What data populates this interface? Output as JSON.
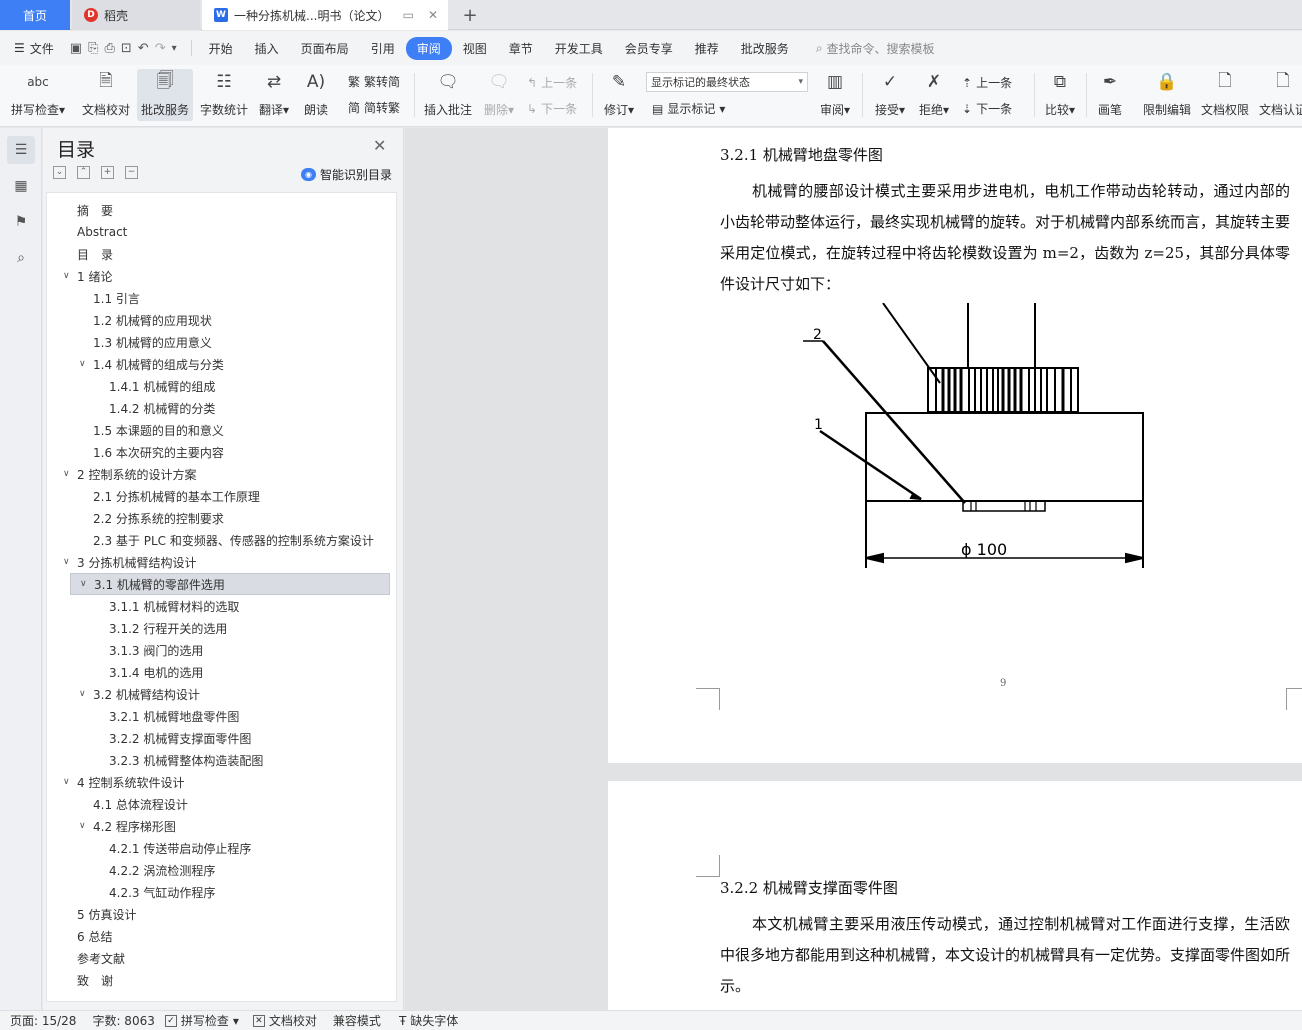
{
  "tabs": {
    "home": "首页",
    "daoke": "稻壳",
    "doc": "一种分拣机械...明书（论文）"
  },
  "menu": {
    "file": "文件",
    "items": [
      "开始",
      "插入",
      "页面布局",
      "引用",
      "审阅",
      "视图",
      "章节",
      "开发工具",
      "会员专享",
      "推荐",
      "批改服务"
    ],
    "active_index": 4,
    "search_placeholder": "查找命令、搜索模板"
  },
  "ribbon": {
    "spell_check": "拼写检查",
    "doc_proof": "文档校对",
    "correction_service": "批改服务",
    "word_count": "字数统计",
    "translate": "翻译",
    "read_aloud": "朗读",
    "trad_to_simp": "繁转简",
    "simp_to_trad": "简转繁",
    "insert_comment": "插入批注",
    "delete": "删除",
    "prev_comment": "上一条",
    "next_comment": "下一条",
    "revise": "修订",
    "markup_state": "显示标记的最终状态",
    "show_markup": "显示标记",
    "review": "审阅",
    "accept": "接受",
    "reject": "拒绝",
    "prev_change": "上一条",
    "next_change": "下一条",
    "compare": "比较",
    "draw": "画笔",
    "restrict_edit": "限制编辑",
    "doc_permission": "文档权限",
    "doc_cert": "文档认证"
  },
  "toc": {
    "title": "目录",
    "smart": "智能识别目录",
    "items": [
      {
        "text": "摘　要",
        "level": 0,
        "chev": false
      },
      {
        "text": "Abstract",
        "level": 0,
        "chev": false
      },
      {
        "text": "目　录",
        "level": 0,
        "chev": false
      },
      {
        "text": "1  绪论",
        "level": 0,
        "chev": true
      },
      {
        "text": "1.1 引言",
        "level": 1,
        "chev": false
      },
      {
        "text": "1.2  机械臂的应用现状",
        "level": 1,
        "chev": false
      },
      {
        "text": "1.3  机械臂的应用意义",
        "level": 1,
        "chev": false
      },
      {
        "text": "1.4 机械臂的组成与分类",
        "level": 1,
        "chev": true
      },
      {
        "text": "1.4.1 机械臂的组成",
        "level": 2,
        "chev": false
      },
      {
        "text": "1.4.2 机械臂的分类",
        "level": 2,
        "chev": false
      },
      {
        "text": "1.5 本课题的目的和意义",
        "level": 1,
        "chev": false
      },
      {
        "text": "1.6  本次研究的主要内容",
        "level": 1,
        "chev": false
      },
      {
        "text": "2  控制系统的设计方案",
        "level": 0,
        "chev": true
      },
      {
        "text": "2.1 分拣机械臂的基本工作原理",
        "level": 1,
        "chev": false
      },
      {
        "text": "2.2 分拣系统的控制要求",
        "level": 1,
        "chev": false
      },
      {
        "text": "2.3 基于 PLC 和变频器、传感器的控制系统方案设计",
        "level": 1,
        "chev": false
      },
      {
        "text": "3  分拣机械臂结构设计",
        "level": 0,
        "chev": true
      },
      {
        "text": "3.1 机械臂的零部件选用",
        "level": 1,
        "chev": true,
        "selected": true
      },
      {
        "text": "3.1.1 机械臂材料的选取",
        "level": 2,
        "chev": false
      },
      {
        "text": "3.1.2 行程开关的选用",
        "level": 2,
        "chev": false
      },
      {
        "text": "3.1.3  阀门的选用",
        "level": 2,
        "chev": false
      },
      {
        "text": "3.1.4  电机的选用",
        "level": 2,
        "chev": false
      },
      {
        "text": "3.2 机械臂结构设计",
        "level": 1,
        "chev": true
      },
      {
        "text": "3.2.1 机械臂地盘零件图",
        "level": 2,
        "chev": false
      },
      {
        "text": "3.2.2 机械臂支撑面零件图",
        "level": 2,
        "chev": false
      },
      {
        "text": "3.2.3 机械臂整体构造装配图",
        "level": 2,
        "chev": false
      },
      {
        "text": "4  控制系统软件设计",
        "level": 0,
        "chev": true
      },
      {
        "text": "4.1 总体流程设计",
        "level": 1,
        "chev": false
      },
      {
        "text": "4.2 程序梯形图",
        "level": 1,
        "chev": true
      },
      {
        "text": "4.2.1 传送带启动停止程序",
        "level": 2,
        "chev": false
      },
      {
        "text": "4.2.2 涡流检测程序",
        "level": 2,
        "chev": false
      },
      {
        "text": "4.2.3 气缸动作程序",
        "level": 2,
        "chev": false
      },
      {
        "text": "5  仿真设计",
        "level": 0,
        "chev": false
      },
      {
        "text": "6  总结",
        "level": 0,
        "chev": false
      },
      {
        "text": "参考文献",
        "level": 0,
        "chev": false
      },
      {
        "text": "致　谢",
        "level": 0,
        "chev": false
      }
    ]
  },
  "doc": {
    "h321": "3.2.1 机械臂地盘零件图",
    "p321": "机械臂的腰部设计模式主要采用步进电机，电机工作带动齿轮转动，通过内部的小齿轮带动整体运行，最终实现机械臂的旋转。对于机械臂内部系统而言，其旋转主要采用定位模式，在旋转过程中将齿轮模数设置为 m=2，齿数为 z=25，其部分具体零件设计尺寸如下：",
    "fig_label_2": "2",
    "fig_label_1": "1",
    "fig_dim": "ϕ 100",
    "page_number": "9",
    "h322": "3.2.2 机械臂支撑面零件图",
    "p322": "本文机械臂主要采用液压传动模式，通过控制机械臂对工作面进行支撑，生活欧中很多地方都能用到这种机械臂，本文设计的机械臂具有一定优势。支撑面零件图如所示。"
  },
  "status": {
    "page": "页面: 15/28",
    "words": "字数: 8063",
    "spell": "拼写检查",
    "proof": "文档校对",
    "compat": "兼容模式",
    "missing_font": "缺失字体"
  }
}
